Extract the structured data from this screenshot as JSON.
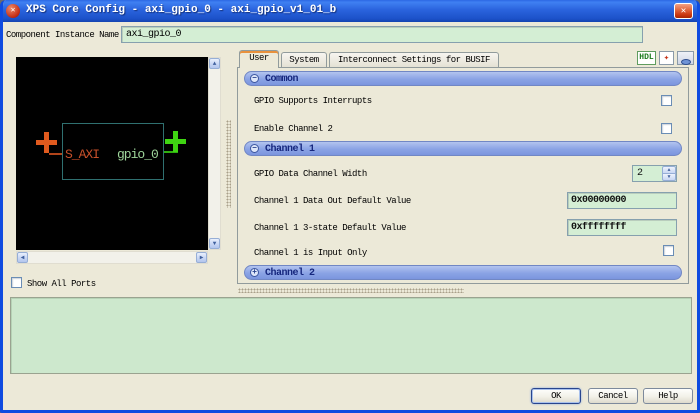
{
  "window": {
    "title": "XPS Core Config - axi_gpio_0 - axi_gpio_v1_01_b",
    "close_glyph": "✕"
  },
  "instance": {
    "label": "Component Instance Name",
    "value": "axi_gpio_0"
  },
  "diagram": {
    "left_port": "S_AXI",
    "right_port": "gpio_0",
    "show_all_ports_label": "Show All Ports"
  },
  "tabs": {
    "user": "User",
    "system": "System",
    "interconnect": "Interconnect Settings for BUSIF"
  },
  "toolbar": {
    "hdl_label": "HDL",
    "pdf_glyph": "✦"
  },
  "sections": {
    "common": {
      "title": "Common",
      "interrupts_label": "GPIO Supports Interrupts",
      "enable_ch2_label": "Enable Channel 2"
    },
    "channel1": {
      "title": "Channel 1",
      "width_label": "GPIO Data Channel Width",
      "width_value": "2",
      "dataout_label": "Channel 1 Data Out Default Value",
      "dataout_value": "0x00000000",
      "tristate_label": "Channel 1 3-state Default Value",
      "tristate_value": "0xffffffff",
      "inputonly_label": "Channel 1 is Input Only"
    },
    "channel2": {
      "title": "Channel 2"
    }
  },
  "icons": {
    "up": "▲",
    "down": "▼",
    "left": "◀",
    "right": "▶",
    "collapse": "−",
    "expand": "+",
    "app": "✕"
  },
  "footer": {
    "ok": "OK",
    "cancel": "Cancel",
    "help": "Help"
  },
  "colors": {
    "title_blue": "#0f4be0",
    "section_blue": "#8aa3e5",
    "field_green": "#d4eed4",
    "info_green": "#cde8cd",
    "canvas_black": "#000000"
  }
}
